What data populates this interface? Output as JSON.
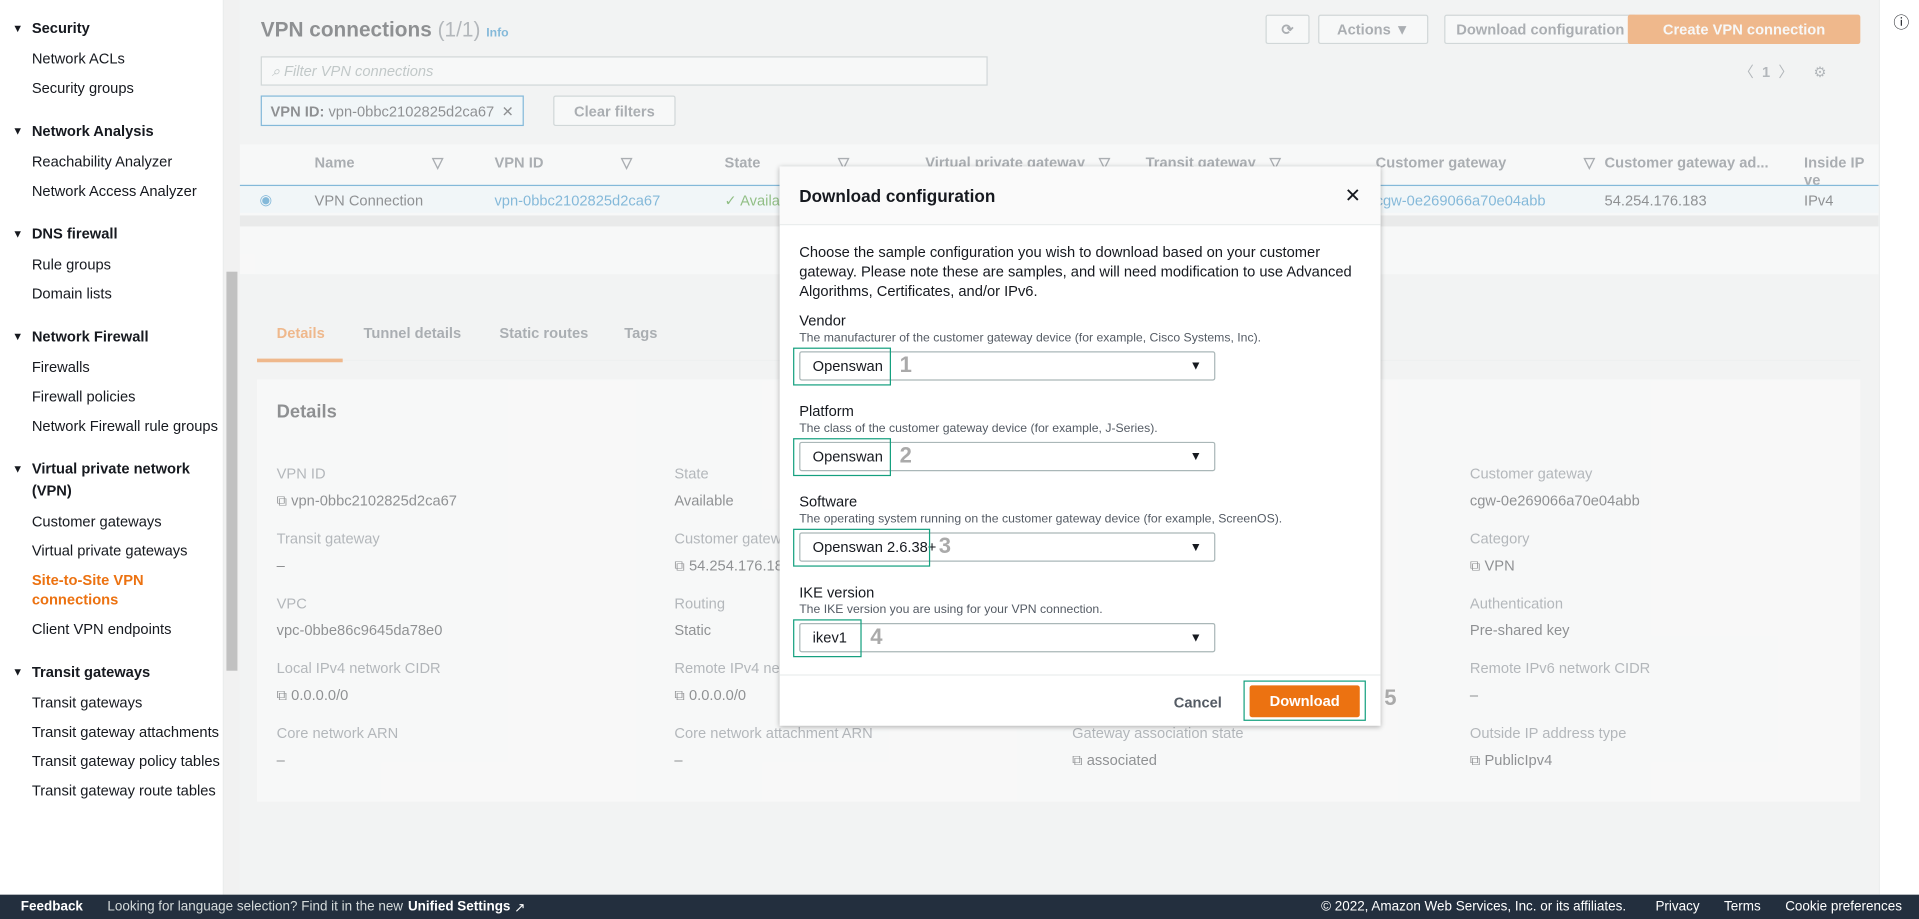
{
  "sidebar": {
    "sections": [
      {
        "title": "Security",
        "items": [
          "Network ACLs",
          "Security groups"
        ]
      },
      {
        "title": "Network Analysis",
        "items": [
          "Reachability Analyzer",
          "Network Access Analyzer"
        ]
      },
      {
        "title": "DNS firewall",
        "items": [
          "Rule groups",
          "Domain lists"
        ]
      },
      {
        "title": "Network Firewall",
        "items": [
          "Firewalls",
          "Firewall policies",
          "Network Firewall rule groups"
        ]
      },
      {
        "title": "Virtual private network (VPN)",
        "items": [
          "Customer gateways",
          "Virtual private gateways",
          "Site-to-Site VPN connections",
          "Client VPN endpoints"
        ]
      },
      {
        "title": "Transit gateways",
        "items": [
          "Transit gateways",
          "Transit gateway attachments",
          "Transit gateway policy tables",
          "Transit gateway route tables"
        ]
      }
    ],
    "active": "Site-to-Site VPN connections"
  },
  "header": {
    "title": "VPN connections",
    "count": "(1/1)",
    "info": "Info",
    "refresh_icon": "refresh-icon",
    "actions": "Actions",
    "download": "Download configuration",
    "create": "Create VPN connection"
  },
  "filter": {
    "placeholder": "Filter VPN connections",
    "token_key": "VPN ID:",
    "token_value": "vpn-0bbc2102825d2ca67",
    "clear": "Clear filters",
    "page": "1"
  },
  "table": {
    "columns": [
      "Name",
      "VPN ID",
      "State",
      "Virtual private gateway",
      "Transit gateway",
      "Customer gateway",
      "Customer gateway ad...",
      "Inside IP ve"
    ],
    "row": {
      "name": "VPN Connection",
      "vpn_id": "vpn-0bbc2102825d2ca67",
      "state": "Available",
      "customer_gateway": "cgw-0e269066a70e04abb",
      "cgw_address": "54.254.176.183",
      "inside_ip": "IPv4"
    }
  },
  "tabs": [
    "Details",
    "Tunnel details",
    "Static routes",
    "Tags"
  ],
  "details": {
    "title": "Details",
    "fields": [
      {
        "label": "VPN ID",
        "value": "vpn-0bbc2102825d2ca67"
      },
      {
        "label": "State",
        "value": "Available"
      },
      {
        "label": "Customer gateway",
        "value": "cgw-0e269066a70e04abb"
      },
      {
        "label": "Transit gateway",
        "value": "–"
      },
      {
        "label": "Customer gateway address",
        "value": "54.254.176.183"
      },
      {
        "label": "Category",
        "value": "VPN"
      },
      {
        "label": "VPC",
        "value": "vpc-0bbe86c9645da78e0"
      },
      {
        "label": "Routing",
        "value": "Static"
      },
      {
        "label": "Authentication",
        "value": "Pre-shared key"
      },
      {
        "label": "Local IPv4 network CIDR",
        "value": "0.0.0.0/0"
      },
      {
        "label": "Remote IPv4 network CIDR",
        "value": "0.0.0.0/0"
      },
      {
        "label": "Remote IPv6 network CIDR",
        "value": "–"
      },
      {
        "label": "Core network ARN",
        "value": "–"
      },
      {
        "label": "Core network attachment ARN",
        "value": "–"
      },
      {
        "label": "Gateway association state",
        "value": "associated"
      },
      {
        "label": "Outside IP address type",
        "value": "PublicIpv4"
      }
    ]
  },
  "modal": {
    "title": "Download configuration",
    "intro": "Choose the sample configuration you wish to download based on your customer gateway. Please note these are samples, and will need modification to use Advanced Algorithms, Certificates, and/or IPv6.",
    "fields": [
      {
        "label": "Vendor",
        "desc": "The manufacturer of the customer gateway device (for example, Cisco Systems, Inc).",
        "value": "Openswan",
        "step": "1"
      },
      {
        "label": "Platform",
        "desc": "The class of the customer gateway device (for example, J-Series).",
        "value": "Openswan",
        "step": "2"
      },
      {
        "label": "Software",
        "desc": "The operating system running on the customer gateway device (for example, ScreenOS).",
        "value": "Openswan 2.6.38+",
        "step": "3"
      },
      {
        "label": "IKE version",
        "desc": "The IKE version you are using for your VPN connection.",
        "value": "ikev1",
        "step": "4"
      }
    ],
    "cancel": "Cancel",
    "download": "Download",
    "download_step": "5",
    "accent": "#ec7211",
    "highlight": "#15a07f"
  },
  "footer": {
    "feedback": "Feedback",
    "lang": "Looking for language selection? Find it in the new",
    "unified": "Unified Settings",
    "copyright": "© 2022, Amazon Web Services, Inc. or its affiliates.",
    "privacy": "Privacy",
    "terms": "Terms",
    "cookies": "Cookie preferences"
  }
}
